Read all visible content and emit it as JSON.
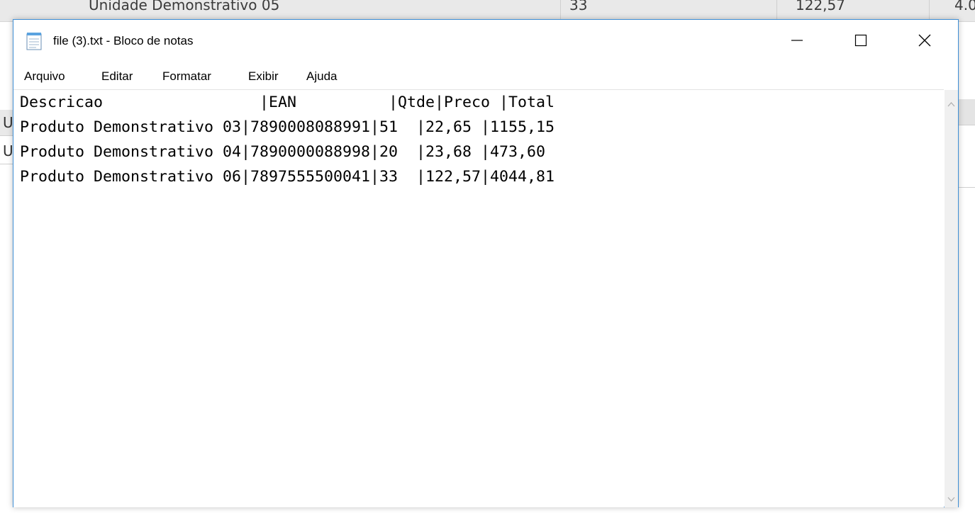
{
  "background": {
    "row_text": "Unidade Demonstrativo 05",
    "row_qty": "33",
    "row_price": "122,57",
    "row_total": "4.0",
    "side_letters": [
      "U",
      "U"
    ]
  },
  "window": {
    "title": "file (3).txt - Bloco de notas",
    "icon": "notepad-icon",
    "controls": {
      "minimize": "minimize-icon",
      "maximize": "maximize-icon",
      "close": "close-icon"
    }
  },
  "menu": {
    "items": [
      "Arquivo",
      "Editar",
      "Formatar",
      "Exibir",
      "Ajuda"
    ]
  },
  "editor": {
    "lines": [
      "Descricao                 |EAN          |Qtde|Preco |Total",
      "Produto Demonstrativo 03|7890008088991|51  |22,65 |1155,15",
      "Produto Demonstrativo 04|7890000088998|20  |23,68 |473,60",
      "Produto Demonstrativo 06|7897555500041|33  |122,57|4044,81"
    ]
  },
  "colors": {
    "window_border": "#3f8fd6",
    "text": "#000000",
    "scrollbar": "#f0f0f0"
  }
}
